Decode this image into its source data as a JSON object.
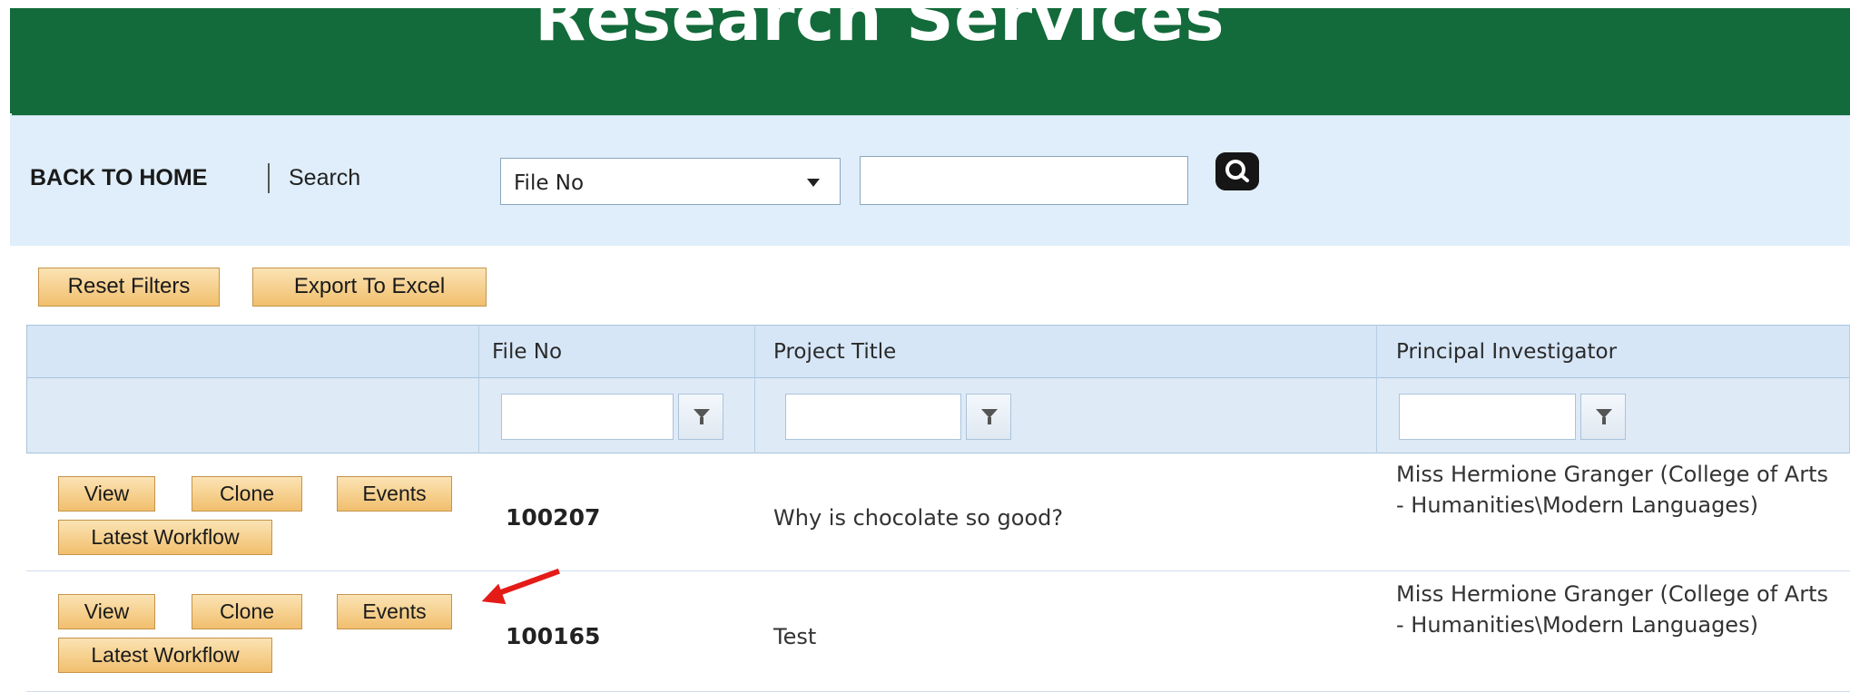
{
  "header": {
    "title": "Research Services"
  },
  "nav": {
    "back_label": "BACK TO HOME",
    "search_label": "Search",
    "select_value": "File No",
    "search_value": "",
    "search_icon": "search-icon"
  },
  "toolbar": {
    "reset_label": "Reset Filters",
    "export_label": "Export To Excel"
  },
  "table": {
    "columns": [
      "",
      "File No",
      "Project Title",
      "Principal Investigator"
    ],
    "filters": {
      "file_no": "",
      "project_title": "",
      "pi": ""
    },
    "filter_icon": "filter-funnel-icon",
    "row_buttons": {
      "view": "View",
      "clone": "Clone",
      "events": "Events",
      "workflow": "Latest Workflow"
    },
    "rows": [
      {
        "file_no": "100207",
        "title": "Why is chocolate so good?",
        "pi": "Miss Hermione Granger (College of Arts - Humanities\\Modern Languages)"
      },
      {
        "file_no": "100165",
        "title": "Test",
        "pi": "Miss Hermione Granger (College of Arts - Humanities\\Modern Languages)"
      }
    ]
  },
  "annotation": {
    "arrow_color": "#e41b17",
    "arrow_icon": "red-arrow-icon"
  },
  "colors": {
    "header_green": "#136a3a",
    "nav_blue": "#dfeefa",
    "button_orange": "#f1bf6d",
    "grid_header": "#d6e6f7"
  }
}
